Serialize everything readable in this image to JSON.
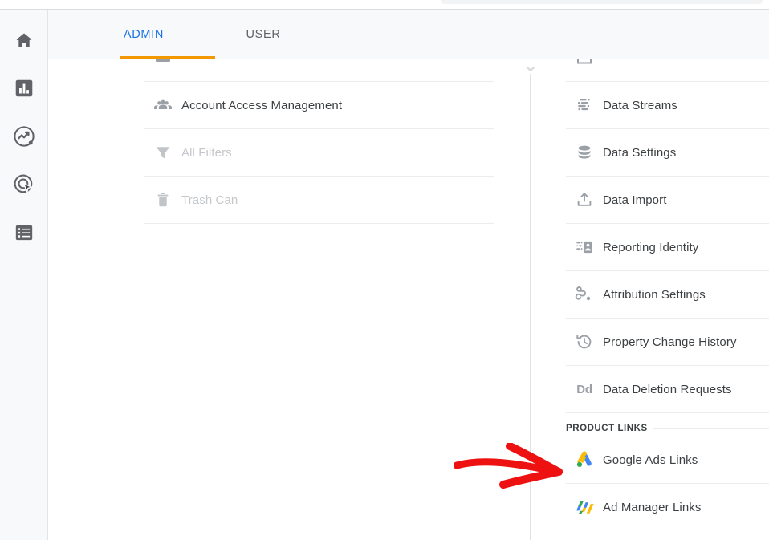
{
  "app": {
    "accent_blue": "#1a73e8",
    "accent_orange": "#f29900",
    "text_color": "#3c4043",
    "disabled_color": "#c5c8cb",
    "icon_color": "#9aa0a6",
    "annotation_color": "#ee1111"
  },
  "rail": {
    "items": [
      {
        "label": "Home",
        "icon": "home-icon"
      },
      {
        "label": "Reports",
        "icon": "bar-chart-icon"
      },
      {
        "label": "Explore",
        "icon": "explore-trend-icon"
      },
      {
        "label": "Advertising",
        "icon": "target-cursor-icon"
      },
      {
        "label": "Configure",
        "icon": "list-icon"
      }
    ]
  },
  "tabs": [
    {
      "label": "ADMIN",
      "selected": true
    },
    {
      "label": "USER",
      "selected": false
    }
  ],
  "left_column": {
    "partial_row": {
      "label": "",
      "icon": "partial-icon"
    },
    "items": [
      {
        "label": "Account Access Management",
        "icon": "people-group-icon",
        "disabled": false
      },
      {
        "label": "All Filters",
        "icon": "funnel-icon",
        "disabled": true
      },
      {
        "label": "Trash Can",
        "icon": "trash-icon",
        "disabled": true
      }
    ]
  },
  "right_column": {
    "partial_row": {
      "label": "",
      "icon": "partial-property-icon"
    },
    "items": [
      {
        "label": "Data Streams",
        "icon": "data-streams-icon"
      },
      {
        "label": "Data Settings",
        "icon": "database-icon"
      },
      {
        "label": "Data Import",
        "icon": "upload-icon"
      },
      {
        "label": "Reporting Identity",
        "icon": "reporting-identity-icon"
      },
      {
        "label": "Attribution Settings",
        "icon": "attribution-icon"
      },
      {
        "label": "Property Change History",
        "icon": "history-icon"
      },
      {
        "label": "Data Deletion Requests",
        "icon": "dd-icon"
      }
    ],
    "section_header": "PRODUCT LINKS",
    "product_links": [
      {
        "label": "Google Ads Links",
        "icon": "google-ads-logo-icon"
      },
      {
        "label": "Ad Manager Links",
        "icon": "ad-manager-logo-icon"
      }
    ]
  },
  "annotation": {
    "type": "red-arrow",
    "points_to": "Google Ads Links",
    "color": "#ee1111"
  }
}
